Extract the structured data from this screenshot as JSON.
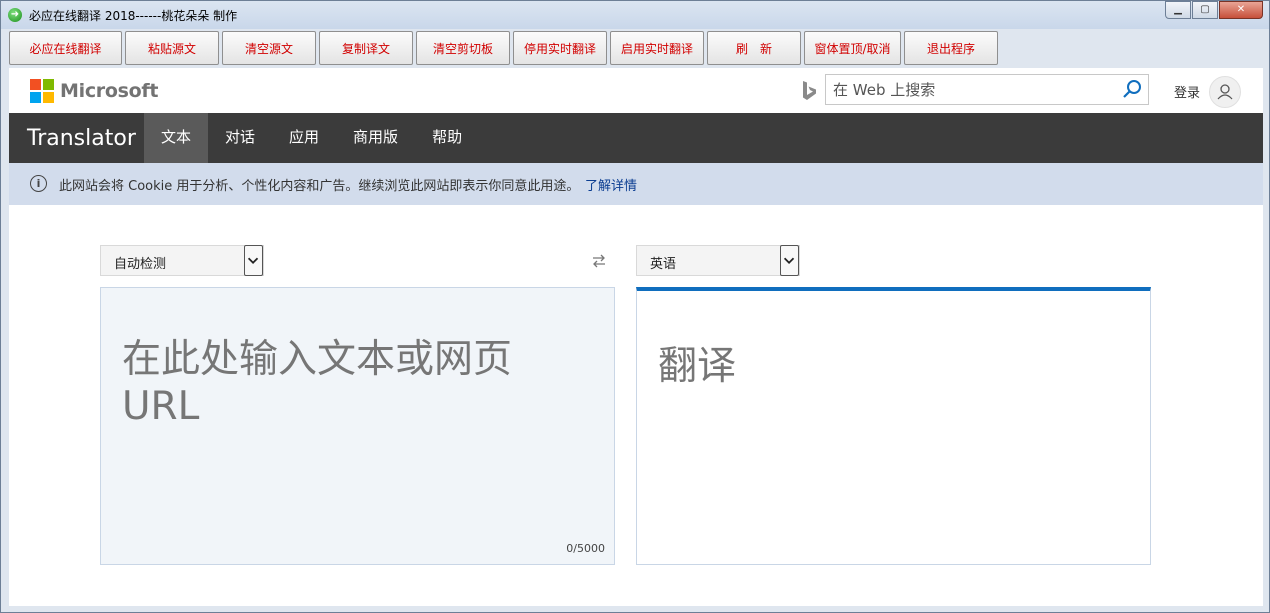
{
  "window": {
    "title": "必应在线翻译 2018------桃花朵朵  制作",
    "controls": [
      "minimize-icon",
      "maximize-icon",
      "close-icon"
    ]
  },
  "toolbar": {
    "buttons": [
      {
        "label": "必应在线翻译"
      },
      {
        "label": "粘贴源文"
      },
      {
        "label": "清空源文"
      },
      {
        "label": "复制译文"
      },
      {
        "label": "清空剪切板"
      },
      {
        "label": "停用实时翻译"
      },
      {
        "label": "启用实时翻译"
      },
      {
        "label": "刷　新"
      },
      {
        "label": "窗体置顶/取消"
      },
      {
        "label": "退出程序"
      }
    ],
    "text_color": "#d10000"
  },
  "header": {
    "brand": "Microsoft",
    "search": {
      "placeholder": "在 Web 上搜索",
      "value": ""
    },
    "signin": "登录"
  },
  "nav": {
    "brand": "Translator",
    "tabs": [
      {
        "label": "文本",
        "active": true
      },
      {
        "label": "对话",
        "active": false
      },
      {
        "label": "应用",
        "active": false
      },
      {
        "label": "商用版",
        "active": false
      },
      {
        "label": "帮助",
        "active": false
      }
    ]
  },
  "cookie": {
    "text": "此网站会将 Cookie 用于分析、个性化内容和广告。继续浏览此网站即表示你同意此用途。",
    "link": "了解详情"
  },
  "translator": {
    "source_lang": "自动检测",
    "target_lang": "英语",
    "source_placeholder": "在此处输入文本或网页 URL",
    "target_placeholder": "翻译",
    "char_count": "0/5000",
    "accent": "#106ebe"
  }
}
